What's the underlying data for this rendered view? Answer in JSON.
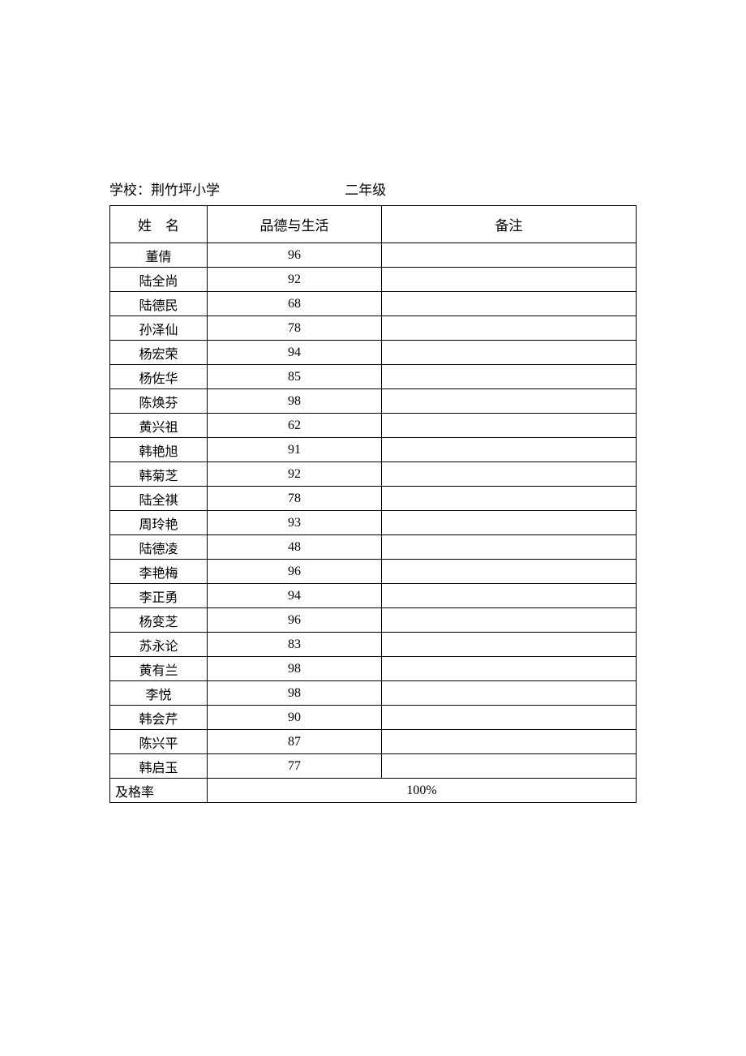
{
  "header": {
    "school_label": "学校：荆竹坪小学",
    "grade_label": "二年级"
  },
  "table": {
    "columns": {
      "name": "姓　名",
      "score": "品德与生活",
      "note": "备注"
    },
    "rows": [
      {
        "name": "董倩",
        "score": "96",
        "note": ""
      },
      {
        "name": "陆全尚",
        "score": "92",
        "note": ""
      },
      {
        "name": "陆德民",
        "score": "68",
        "note": ""
      },
      {
        "name": "孙泽仙",
        "score": "78",
        "note": ""
      },
      {
        "name": "杨宏荣",
        "score": "94",
        "note": ""
      },
      {
        "name": "杨佐华",
        "score": "85",
        "note": ""
      },
      {
        "name": "陈焕芬",
        "score": "98",
        "note": ""
      },
      {
        "name": "黄兴祖",
        "score": "62",
        "note": ""
      },
      {
        "name": "韩艳旭",
        "score": "91",
        "note": ""
      },
      {
        "name": "韩菊芝",
        "score": "92",
        "note": ""
      },
      {
        "name": "陆全祺",
        "score": "78",
        "note": ""
      },
      {
        "name": "周玲艳",
        "score": "93",
        "note": ""
      },
      {
        "name": "陆德凌",
        "score": "48",
        "note": ""
      },
      {
        "name": "李艳梅",
        "score": "96",
        "note": ""
      },
      {
        "name": "李正勇",
        "score": "94",
        "note": ""
      },
      {
        "name": "杨变芝",
        "score": "96",
        "note": ""
      },
      {
        "name": "苏永论",
        "score": "83",
        "note": ""
      },
      {
        "name": "黄有兰",
        "score": "98",
        "note": ""
      },
      {
        "name": "李悦",
        "score": "98",
        "note": ""
      },
      {
        "name": "韩会芹",
        "score": "90",
        "note": ""
      },
      {
        "name": "陈兴平",
        "score": "87",
        "note": ""
      },
      {
        "name": "韩启玉",
        "score": "77",
        "note": ""
      }
    ],
    "footer": {
      "label": "及格率",
      "value": "100%"
    }
  }
}
